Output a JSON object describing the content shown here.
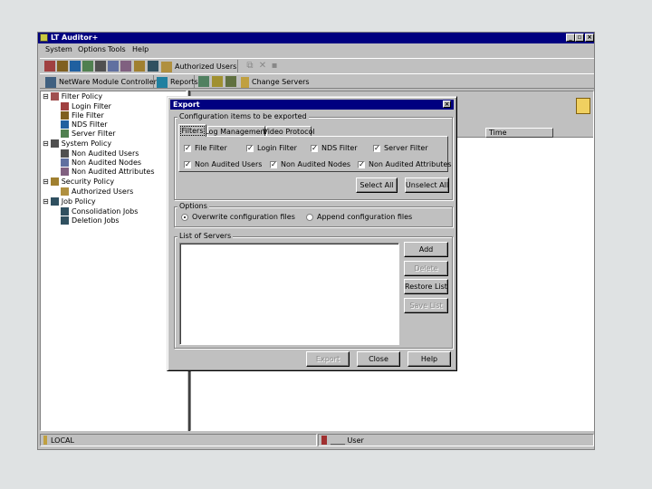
{
  "app": {
    "title": "LT Auditor+",
    "menu": [
      "System",
      "Options",
      "Tools",
      "Help"
    ]
  },
  "toolbar2": {
    "netware_controller": "NetWare Module Controller",
    "reports": "Reports",
    "change_servers": "Change Servers"
  },
  "toolbar1": {
    "authorized_users": "Authorized Users"
  },
  "tree": {
    "items": [
      {
        "label": "Filter Policy",
        "level": 0
      },
      {
        "label": "Login Filter",
        "level": 1
      },
      {
        "label": "File Filter",
        "level": 1
      },
      {
        "label": "NDS Filter",
        "level": 1
      },
      {
        "label": "Server Filter",
        "level": 1
      },
      {
        "label": "System Policy",
        "level": 0
      },
      {
        "label": "Non Audited Users",
        "level": 1
      },
      {
        "label": "Non Audited Nodes",
        "level": 1
      },
      {
        "label": "Non Audited Attributes",
        "level": 1
      },
      {
        "label": "Security Policy",
        "level": 0
      },
      {
        "label": "Authorized Users",
        "level": 1
      },
      {
        "label": "Job Policy",
        "level": 0
      },
      {
        "label": "Consolidation Jobs",
        "level": 1
      },
      {
        "label": "Deletion Jobs",
        "level": 1
      }
    ]
  },
  "rightpane": {
    "column_time": "Time"
  },
  "statusbar": {
    "left": "LOCAL",
    "right": "____ User"
  },
  "dialog": {
    "title": "Export",
    "group_config": "Configuration items to be exported",
    "tabs": [
      "Filters",
      "Log Management",
      "Video Protocol"
    ],
    "checkboxes_row1": [
      {
        "label": "File Filter",
        "checked": true
      },
      {
        "label": "Login Filter",
        "checked": true
      },
      {
        "label": "NDS Filter",
        "checked": true
      },
      {
        "label": "Server Filter",
        "checked": true
      }
    ],
    "checkboxes_row2": [
      {
        "label": "Non Audited Users",
        "checked": true
      },
      {
        "label": "Non Audited Nodes",
        "checked": true
      },
      {
        "label": "Non Audited Attributes",
        "checked": true
      }
    ],
    "select_all": "Select All",
    "unselect_all": "Unselect All",
    "group_options": "Options",
    "option_overwrite": "Overwrite configuration files",
    "option_append": "Append configuration files",
    "group_servers": "List of Servers",
    "add": "Add",
    "delete": "Delete",
    "restore_list": "Restore List",
    "save_list": "Save List",
    "export": "Export",
    "close": "Close",
    "help": "Help"
  }
}
